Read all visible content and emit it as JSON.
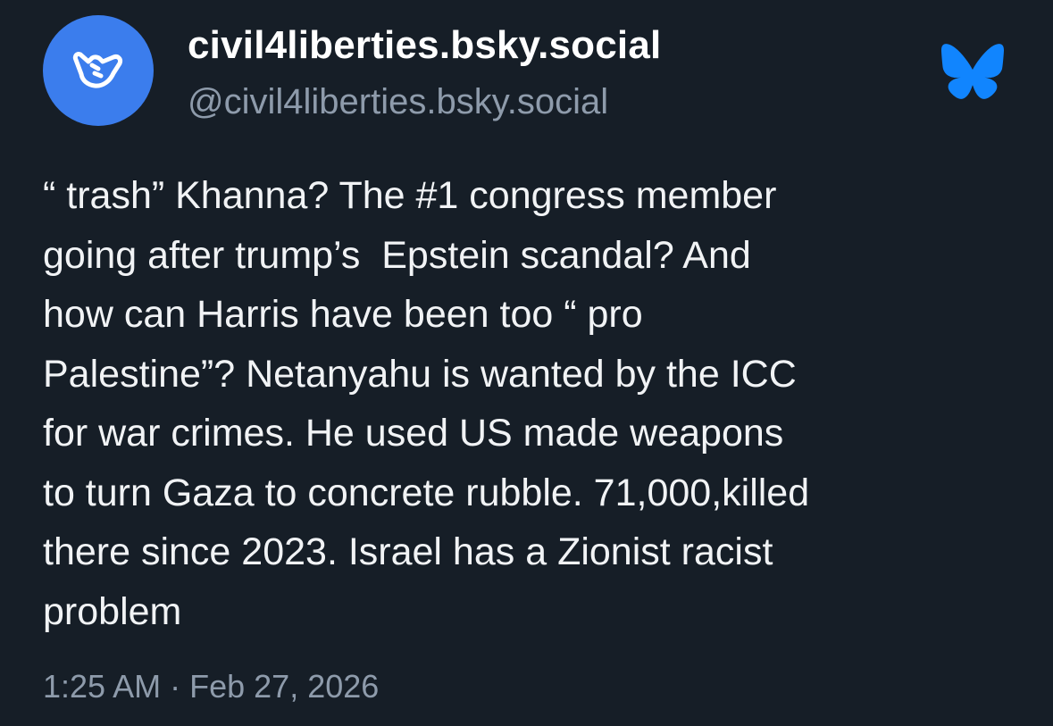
{
  "author": {
    "display_name": "civil4liberties.bsky.social",
    "handle": "@civil4liberties.bsky.social",
    "avatar_icon": "shaka-hand-icon",
    "avatar_color": "#3b7ded"
  },
  "app": {
    "logo_icon": "bluesky-butterfly-icon",
    "logo_color": "#1185fe"
  },
  "post": {
    "lines": [
      "“ trash” Khanna? The #1 congress member",
      "going after trump’s  Epstein scandal? And",
      "how can Harris have been too “ pro",
      "Palestine”? Netanyahu is wanted by the ICC",
      "for war crimes. He used US made weapons",
      "to turn Gaza to concrete rubble. 71,000,killed",
      "there since 2023. Israel has a Zionist racist",
      "problem"
    ],
    "time": "1:25 AM",
    "separator": "·",
    "date": "Feb 27, 2026"
  }
}
